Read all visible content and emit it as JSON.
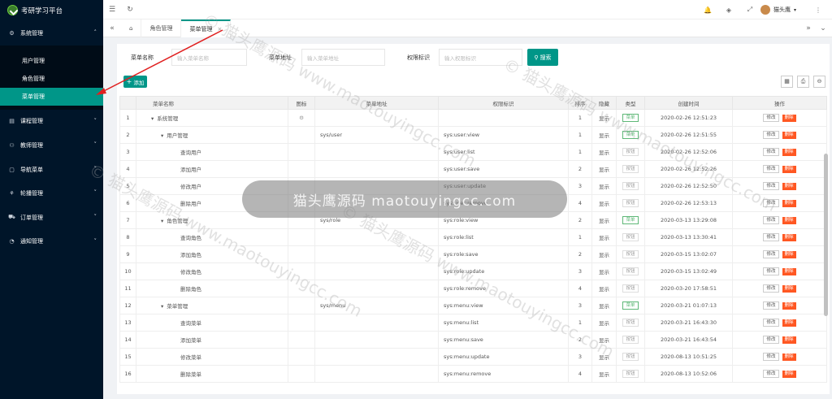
{
  "app": {
    "title": "考研学习平台"
  },
  "sidebar": {
    "items": [
      {
        "label": "系统管理",
        "icon": "gear-icon"
      },
      {
        "label": "课程管理",
        "icon": "book-icon"
      },
      {
        "label": "教师管理",
        "icon": "user-icon"
      },
      {
        "label": "导航菜单",
        "icon": "nav-icon"
      },
      {
        "label": "轮播管理",
        "icon": "image-icon"
      },
      {
        "label": "订单管理",
        "icon": "cart-icon"
      },
      {
        "label": "通知管理",
        "icon": "bell-icon"
      }
    ],
    "sub_items": [
      "用户管理",
      "角色管理",
      "菜单管理"
    ]
  },
  "header": {
    "user": "猫头鹰"
  },
  "tabs": [
    {
      "label": "角色管理"
    },
    {
      "label": "菜单管理"
    }
  ],
  "search": {
    "menu_name_label": "菜单名称",
    "menu_name_placeholder": "输入菜单名称",
    "menu_url_label": "菜单地址",
    "menu_url_placeholder": "输入菜单地址",
    "perm_label": "权限标识",
    "perm_placeholder": "输入权限标识",
    "search_button": "搜索"
  },
  "toolbar": {
    "add_label": "添加"
  },
  "table": {
    "headers": [
      "菜单名称",
      "图标",
      "菜单地址",
      "权限标识",
      "排序",
      "隐藏",
      "类型",
      "创建时间",
      "操作"
    ],
    "edit_label": "修改",
    "delete_label": "删除",
    "rows": [
      {
        "no": "1",
        "name": "系统管理",
        "indent": 0,
        "arrow": true,
        "icon": true,
        "url": "",
        "perm": "",
        "sort": "1",
        "hide": "显示",
        "type": "菜单",
        "menu": true,
        "time": "2020-02-26 12:51:23"
      },
      {
        "no": "2",
        "name": "用户管理",
        "indent": 1,
        "arrow": true,
        "icon": false,
        "url": "sys/user",
        "perm": "sys:user:view",
        "sort": "1",
        "hide": "显示",
        "type": "菜单",
        "menu": true,
        "time": "2020-02-26 12:51:55"
      },
      {
        "no": "3",
        "name": "查询用户",
        "indent": 2,
        "arrow": false,
        "icon": false,
        "url": "",
        "perm": "sys:user:list",
        "sort": "1",
        "hide": "显示",
        "type": "按钮",
        "menu": false,
        "time": "2020-02-26 12:52:06"
      },
      {
        "no": "4",
        "name": "添加用户",
        "indent": 2,
        "arrow": false,
        "icon": false,
        "url": "",
        "perm": "sys:user:save",
        "sort": "2",
        "hide": "显示",
        "type": "按钮",
        "menu": false,
        "time": "2020-02-26 12:52:26"
      },
      {
        "no": "5",
        "name": "修改用户",
        "indent": 2,
        "arrow": false,
        "icon": false,
        "url": "",
        "perm": "sys:user:update",
        "sort": "3",
        "hide": "显示",
        "type": "按钮",
        "menu": false,
        "time": "2020-02-26 12:52:50"
      },
      {
        "no": "6",
        "name": "删除用户",
        "indent": 2,
        "arrow": false,
        "icon": false,
        "url": "",
        "perm": "sys:user:remove",
        "sort": "4",
        "hide": "显示",
        "type": "按钮",
        "menu": false,
        "time": "2020-02-26 12:53:13"
      },
      {
        "no": "7",
        "name": "角色管理",
        "indent": 1,
        "arrow": true,
        "icon": false,
        "url": "sys/role",
        "perm": "sys:role:view",
        "sort": "2",
        "hide": "显示",
        "type": "菜单",
        "menu": true,
        "time": "2020-03-13 13:29:08"
      },
      {
        "no": "8",
        "name": "查询角色",
        "indent": 2,
        "arrow": false,
        "icon": false,
        "url": "",
        "perm": "sys:role:list",
        "sort": "1",
        "hide": "显示",
        "type": "按钮",
        "menu": false,
        "time": "2020-03-13 13:30:41"
      },
      {
        "no": "9",
        "name": "添加角色",
        "indent": 2,
        "arrow": false,
        "icon": false,
        "url": "",
        "perm": "sys:role:save",
        "sort": "2",
        "hide": "显示",
        "type": "按钮",
        "menu": false,
        "time": "2020-03-15 13:02:07"
      },
      {
        "no": "10",
        "name": "修改角色",
        "indent": 2,
        "arrow": false,
        "icon": false,
        "url": "",
        "perm": "sys:role:update",
        "sort": "3",
        "hide": "显示",
        "type": "按钮",
        "menu": false,
        "time": "2020-03-15 13:02:49"
      },
      {
        "no": "11",
        "name": "删除角色",
        "indent": 2,
        "arrow": false,
        "icon": false,
        "url": "",
        "perm": "sys:role:remove",
        "sort": "4",
        "hide": "显示",
        "type": "按钮",
        "menu": false,
        "time": "2020-03-20 17:58:51"
      },
      {
        "no": "12",
        "name": "菜单管理",
        "indent": 1,
        "arrow": true,
        "icon": false,
        "url": "sys/menu",
        "perm": "sys:menu:view",
        "sort": "3",
        "hide": "显示",
        "type": "菜单",
        "menu": true,
        "time": "2020-03-21 01:07:13"
      },
      {
        "no": "13",
        "name": "查询菜单",
        "indent": 2,
        "arrow": false,
        "icon": false,
        "url": "",
        "perm": "sys:menu:list",
        "sort": "1",
        "hide": "显示",
        "type": "按钮",
        "menu": false,
        "time": "2020-03-21 16:43:30"
      },
      {
        "no": "14",
        "name": "添加菜单",
        "indent": 2,
        "arrow": false,
        "icon": false,
        "url": "",
        "perm": "sys:menu:save",
        "sort": "2",
        "hide": "显示",
        "type": "按钮",
        "menu": false,
        "time": "2020-03-21 16:43:54"
      },
      {
        "no": "15",
        "name": "修改菜单",
        "indent": 2,
        "arrow": false,
        "icon": false,
        "url": "",
        "perm": "sys:menu:update",
        "sort": "3",
        "hide": "显示",
        "type": "按钮",
        "menu": false,
        "time": "2020-08-13 10:51:25"
      },
      {
        "no": "16",
        "name": "删除菜单",
        "indent": 2,
        "arrow": false,
        "icon": false,
        "url": "",
        "perm": "sys:menu:remove",
        "sort": "4",
        "hide": "显示",
        "type": "按钮",
        "menu": false,
        "time": "2020-08-13 10:52:06"
      }
    ]
  },
  "watermark": {
    "text": "猫头鹰源码 maotouyingcc.com",
    "bg_text": "© 猫头鹰源码 www.maotouyingcc.com"
  },
  "colors": {
    "accent": "#009688",
    "sidebar": "#001529",
    "danger": "#ff5722"
  }
}
